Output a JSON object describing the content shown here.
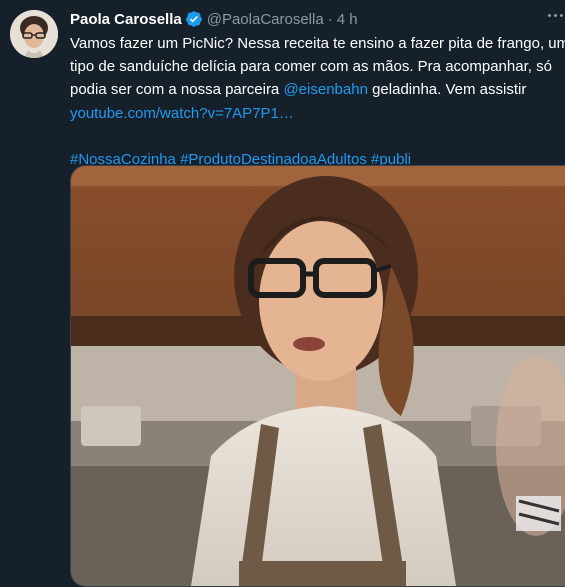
{
  "tweet": {
    "author_name": "Paola Carosella",
    "author_handle": "@PaolaCarosella",
    "separator": "·",
    "time": "4 h",
    "verified_icon": "verified-badge-icon",
    "more_icon": "more-dots-icon",
    "text": {
      "part1": "Vamos fazer um PicNic? Nessa receita te ensino a fazer pita de frango, um tipo de sanduíche delícia para comer com as mãos. Pra acompanhar, só podia ser com a nossa parceira ",
      "mention": "@eisenbahn",
      "part2": " geladinha. Vem assistir ",
      "link": "youtube.com/watch?v=7AP7P1…"
    },
    "hashtags": [
      "#NossaCozinha",
      "#ProdutoDestinadoaAdultos",
      "#publi"
    ],
    "media_alt": "video-thumbnail"
  },
  "colors": {
    "background": "#15202b",
    "link": "#1d9bf0",
    "secondary_text": "#8b98a5",
    "verified": "#1d9bf0"
  }
}
